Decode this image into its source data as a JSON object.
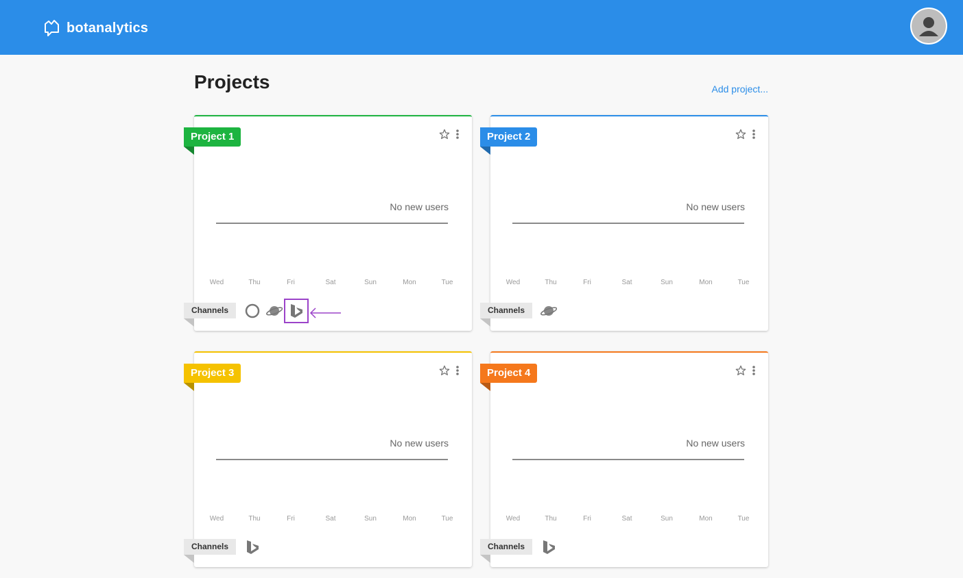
{
  "header": {
    "brand": "botanalytics",
    "bg_color": "#2b8de8"
  },
  "page": {
    "title": "Projects",
    "add_link": "Add project..."
  },
  "projects": [
    {
      "name": "Project 1",
      "color": "#1db440",
      "no_data_text": "No new users",
      "days": [
        "Wed",
        "Thu",
        "Fri",
        "Sat",
        "Sun",
        "Mon",
        "Tue"
      ],
      "channels_label": "Channels",
      "channels": [
        "circle-icon",
        "saturn-icon",
        "bing-icon"
      ],
      "highlighted_channel": "bing-icon"
    },
    {
      "name": "Project 2",
      "color": "#2b8de8",
      "no_data_text": "No new users",
      "days": [
        "Wed",
        "Thu",
        "Fri",
        "Sat",
        "Sun",
        "Mon",
        "Tue"
      ],
      "channels_label": "Channels",
      "channels": [
        "saturn-icon"
      ]
    },
    {
      "name": "Project 3",
      "color": "#f5c200",
      "no_data_text": "No new users",
      "days": [
        "Wed",
        "Thu",
        "Fri",
        "Sat",
        "Sun",
        "Mon",
        "Tue"
      ],
      "channels_label": "Channels",
      "channels": [
        "bing-icon"
      ]
    },
    {
      "name": "Project 4",
      "color": "#f5781c",
      "no_data_text": "No new users",
      "days": [
        "Wed",
        "Thu",
        "Fri",
        "Sat",
        "Sun",
        "Mon",
        "Tue"
      ],
      "channels_label": "Channels",
      "channels": [
        "bing-icon"
      ]
    }
  ]
}
